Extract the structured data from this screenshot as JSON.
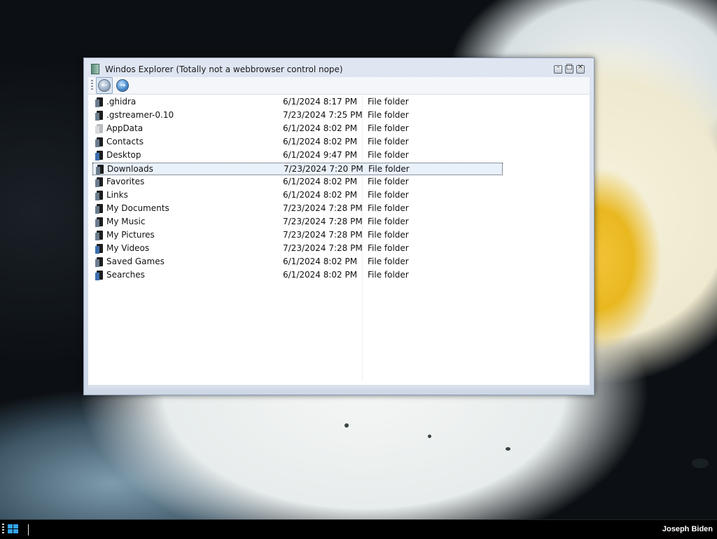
{
  "window": {
    "title": "Windos Explorer (Totally not a webbrowser control nope)",
    "min_glyph": "–",
    "max_glyph": "□",
    "close_glyph": "×"
  },
  "toolbar": {
    "back_glyph": "←",
    "forward_glyph": "→"
  },
  "files": [
    {
      "name": ".ghidra",
      "date": "6/1/2024 8:17 PM",
      "type": "File folder",
      "icon": "folder-dark"
    },
    {
      "name": ".gstreamer-0.10",
      "date": "7/23/2024 7:25 PM",
      "type": "File folder",
      "icon": "folder-dark"
    },
    {
      "name": "AppData",
      "date": "6/1/2024 8:02 PM",
      "type": "File folder",
      "icon": "folder-hidden"
    },
    {
      "name": "Contacts",
      "date": "6/1/2024 8:02 PM",
      "type": "File folder",
      "icon": "contacts-folder"
    },
    {
      "name": "Desktop",
      "date": "6/1/2024 9:47 PM",
      "type": "File folder",
      "icon": "desktop-folder"
    },
    {
      "name": "Downloads",
      "date": "7/23/2024 7:20 PM",
      "type": "File folder",
      "icon": "downloads-folder"
    },
    {
      "name": "Favorites",
      "date": "6/1/2024 8:02 PM",
      "type": "File folder",
      "icon": "favorites-folder"
    },
    {
      "name": "Links",
      "date": "6/1/2024 8:02 PM",
      "type": "File folder",
      "icon": "links-folder"
    },
    {
      "name": "My Documents",
      "date": "7/23/2024 7:28 PM",
      "type": "File folder",
      "icon": "documents-folder"
    },
    {
      "name": "My Music",
      "date": "7/23/2024 7:28 PM",
      "type": "File folder",
      "icon": "music-folder"
    },
    {
      "name": "My Pictures",
      "date": "7/23/2024 7:28 PM",
      "type": "File folder",
      "icon": "pictures-folder"
    },
    {
      "name": "My Videos",
      "date": "7/23/2024 7:28 PM",
      "type": "File folder",
      "icon": "videos-folder"
    },
    {
      "name": "Saved Games",
      "date": "6/1/2024 8:02 PM",
      "type": "File folder",
      "icon": "games-folder"
    },
    {
      "name": "Searches",
      "date": "6/1/2024 8:02 PM",
      "type": "File folder",
      "icon": "searches-folder"
    }
  ],
  "selected_index": 5,
  "taskbar": {
    "user_name": "Joseph Biden"
  }
}
